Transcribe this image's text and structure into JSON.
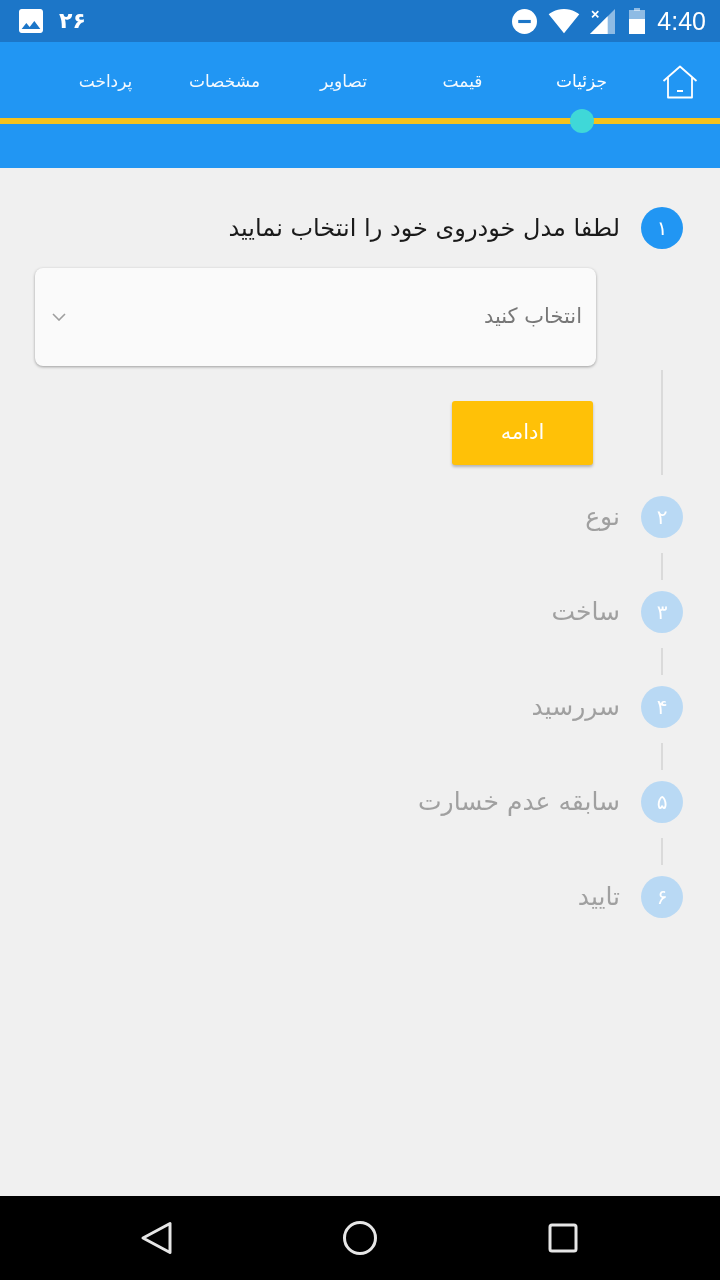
{
  "status_bar": {
    "notification_count": "۲۶",
    "time": "4:40"
  },
  "app_bar": {
    "tabs": [
      {
        "label": "جزئیات",
        "selected": true
      },
      {
        "label": "قیمت",
        "selected": false
      },
      {
        "label": "تصاویر",
        "selected": false
      },
      {
        "label": "مشخصات",
        "selected": false
      },
      {
        "label": "پرداخت",
        "selected": false
      }
    ]
  },
  "steps": [
    {
      "number": "۱",
      "label": "لطفا مدل خودروی خود را انتخاب نمایید",
      "active": true,
      "form": {
        "placeholder": "انتخاب کنید",
        "button": "ادامه"
      }
    },
    {
      "number": "۲",
      "label": "نوع",
      "active": false
    },
    {
      "number": "۳",
      "label": "ساخت",
      "active": false
    },
    {
      "number": "۴",
      "label": "سررسید",
      "active": false
    },
    {
      "number": "۵",
      "label": "سابقه عدم خسارت",
      "active": false
    },
    {
      "number": "۶",
      "label": "تایید",
      "active": false
    }
  ]
}
